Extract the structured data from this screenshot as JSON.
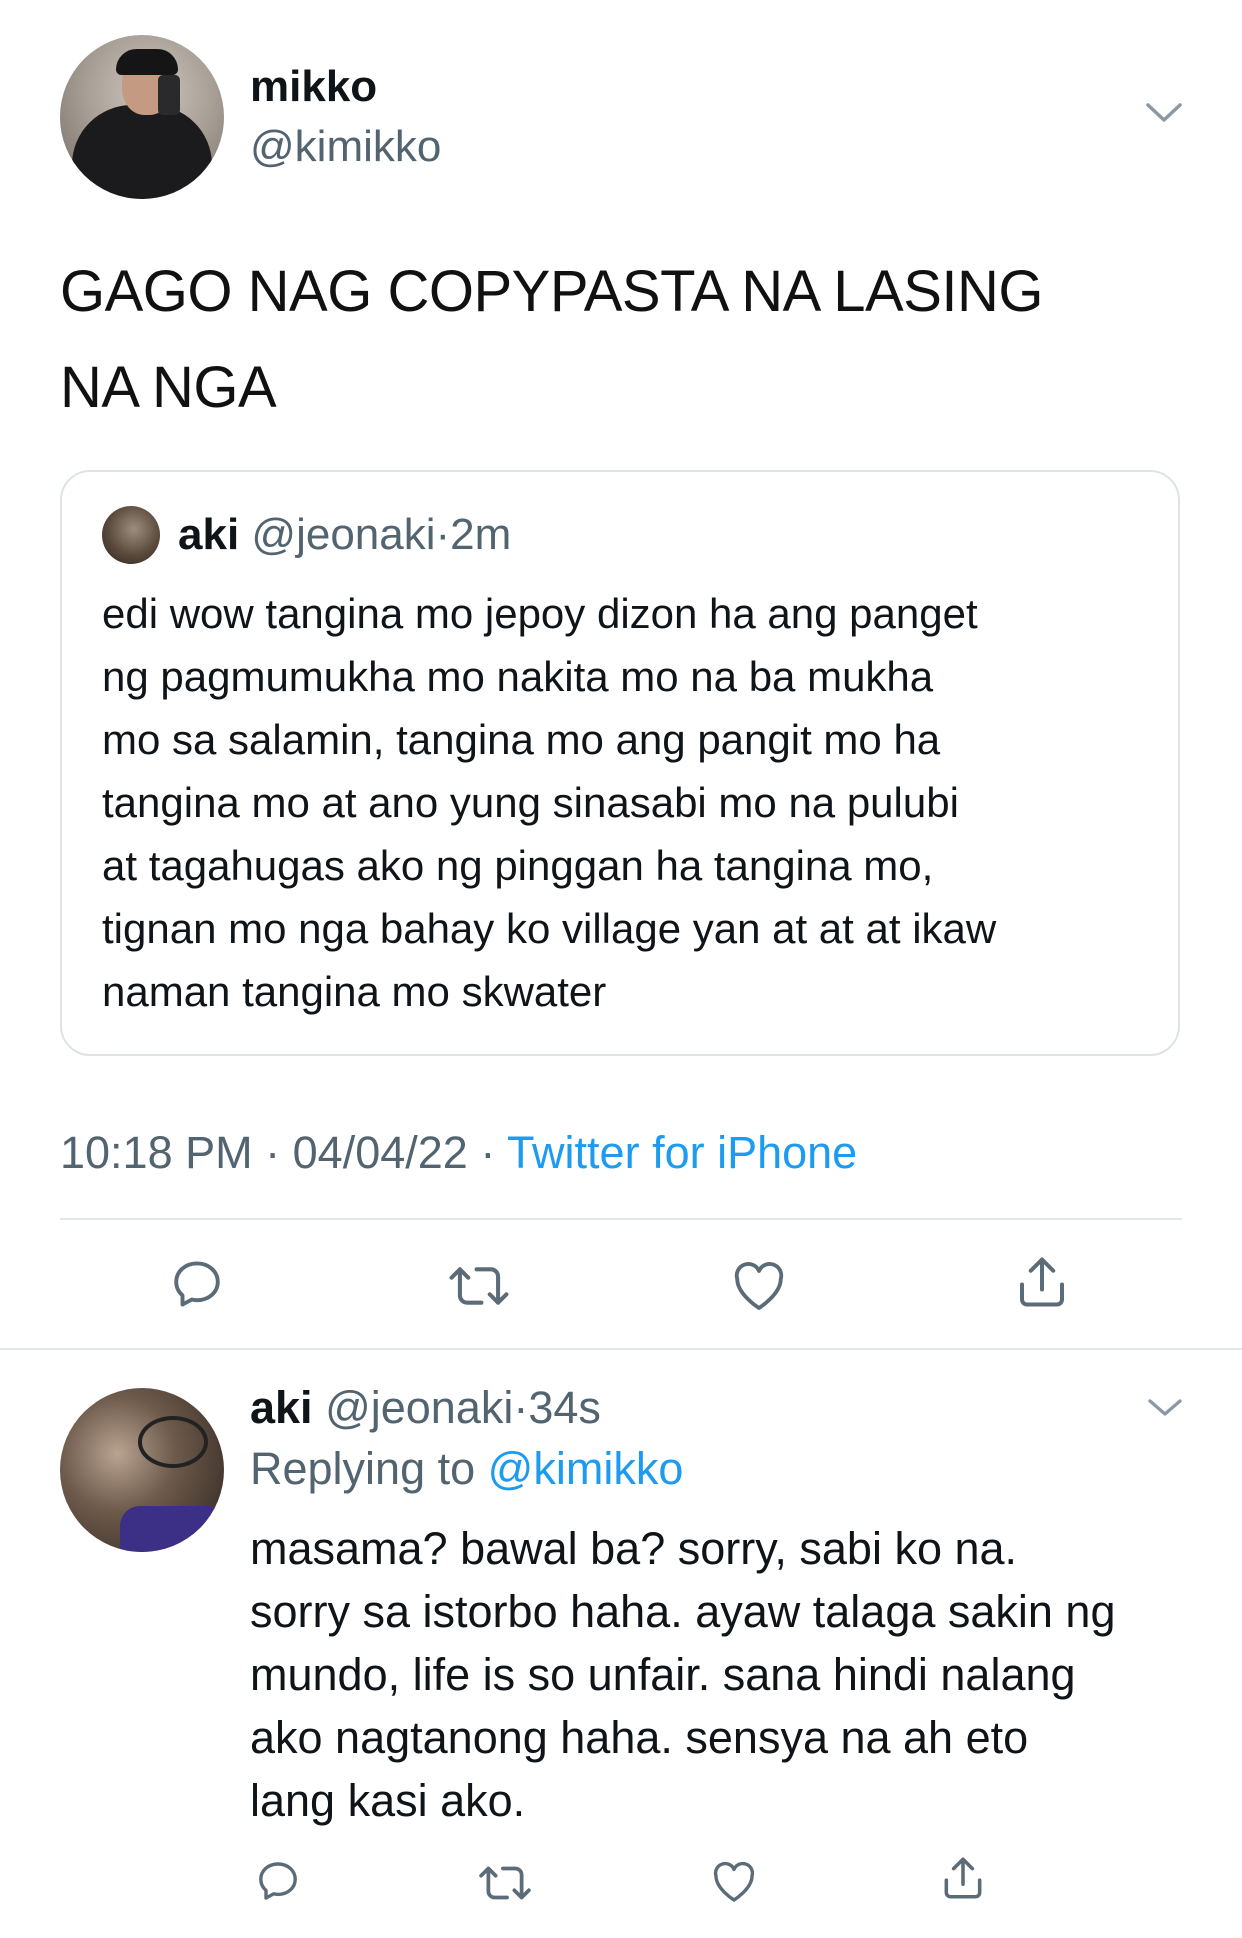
{
  "tweet": {
    "author_name": "mikko",
    "author_handle": "@kimikko",
    "text_line1": "GAGO NAG COPYPASTA NA LASING",
    "text_line2": "NA NGA",
    "time": "10:18 PM",
    "date": "04/04/22",
    "source": "Twitter for iPhone",
    "dot": "·"
  },
  "quoted": {
    "author_name": "aki",
    "author_handle": "@jeonaki",
    "time": "2m",
    "dot": "·",
    "lines": [
      "edi wow tangina mo jepoy dizon ha ang panget",
      "ng pagmumukha mo nakita mo na ba mukha",
      "mo sa salamin, tangina mo ang pangit mo ha",
      "tangina mo at ano yung sinasabi mo na pulubi",
      "at tagahugas ako ng pinggan ha tangina mo,",
      "tignan mo nga bahay ko village yan at at at ikaw",
      "naman tangina mo skwater"
    ]
  },
  "reply": {
    "author_name": "aki",
    "author_handle": "@jeonaki",
    "time": "34s",
    "dot": "·",
    "replying_label": "Replying to",
    "replying_handle": "@kimikko",
    "lines": [
      "masama? bawal ba? sorry, sabi ko na.",
      "sorry sa istorbo haha. ayaw talaga sakin ng",
      "mundo, life is so unfair. sana hindi nalang",
      "ako nagtanong haha. sensya na ah eto",
      "lang kasi ako."
    ]
  },
  "icons": {
    "chevron": "chevron-down-icon",
    "reply": "reply-icon",
    "retweet": "retweet-icon",
    "like": "heart-icon",
    "share": "share-icon"
  },
  "colors": {
    "link": "#1d9bf0",
    "secondary": "#536471",
    "divider": "#e3e7ea"
  }
}
